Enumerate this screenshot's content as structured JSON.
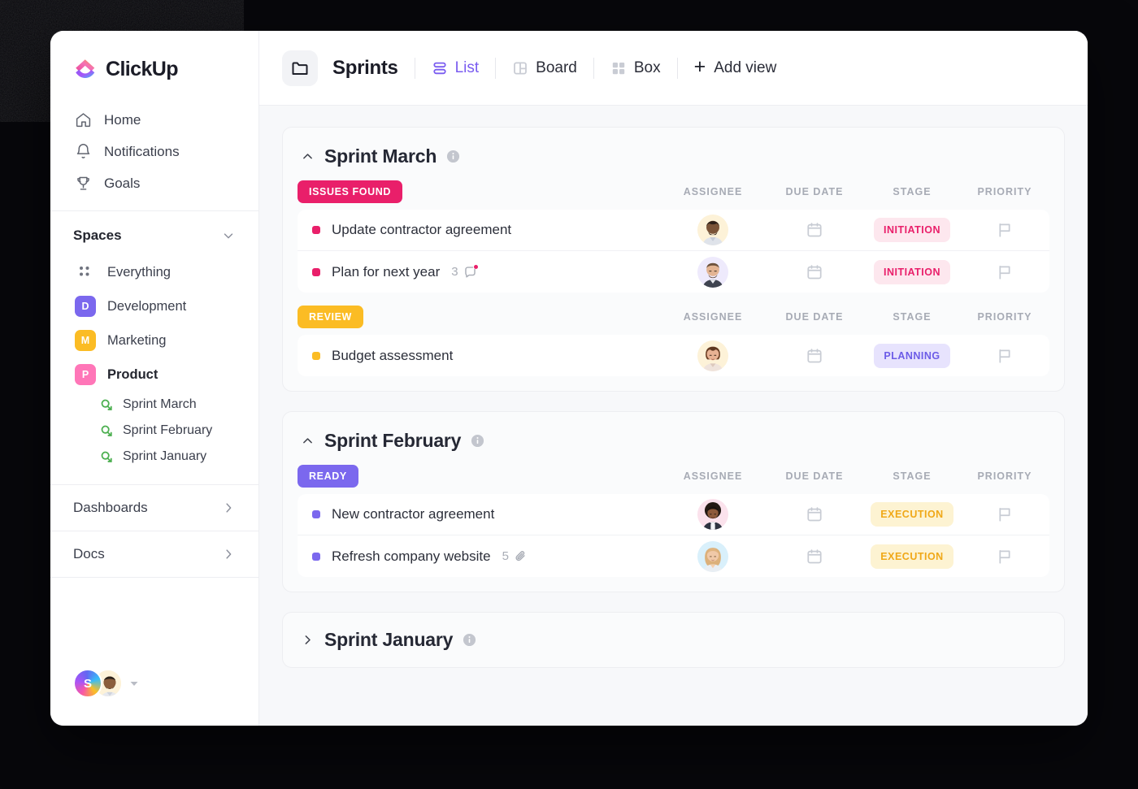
{
  "window": {
    "brand": {
      "name": "ClickUp",
      "icon": "clickup-logo"
    }
  },
  "sidebar": {
    "nav": [
      {
        "label": "Home",
        "icon": "home-icon"
      },
      {
        "label": "Notifications",
        "icon": "bell-icon"
      },
      {
        "label": "Goals",
        "icon": "trophy-icon"
      }
    ],
    "spaces_header": {
      "label": "Spaces",
      "icon": "chevron-down-icon"
    },
    "everything": {
      "label": "Everything",
      "icon": "grid-dots-icon"
    },
    "spaces": [
      {
        "label": "Development",
        "initial": "D",
        "color": "#7b68ee",
        "active": false
      },
      {
        "label": "Marketing",
        "initial": "M",
        "color": "#fbbc24",
        "active": false
      },
      {
        "label": "Product",
        "initial": "P",
        "color": "#ff76b8",
        "active": true
      }
    ],
    "sprints": [
      {
        "label": "Sprint  March",
        "icon": "sprint-icon"
      },
      {
        "label": "Sprint  February",
        "icon": "sprint-icon"
      },
      {
        "label": "Sprint January",
        "icon": "sprint-icon"
      }
    ],
    "collapsibles": [
      {
        "label": "Dashboards",
        "icon": "chevron-right-icon"
      },
      {
        "label": "Docs",
        "icon": "chevron-right-icon"
      }
    ],
    "user": {
      "workspace_initial": "S",
      "avatar": "user-avatar",
      "caret": "caret-down-icon"
    }
  },
  "topbar": {
    "folder_icon": "folder-icon",
    "title": "Sprints",
    "views": [
      {
        "label": "List",
        "icon": "list-view-icon",
        "active": true
      },
      {
        "label": "Board",
        "icon": "board-view-icon",
        "active": false
      },
      {
        "label": "Box",
        "icon": "box-view-icon",
        "active": false
      }
    ],
    "add_view": {
      "label": "Add view",
      "icon": "plus-icon"
    }
  },
  "columns": {
    "assignee": "ASSIGNEE",
    "due_date": "DUE DATE",
    "stage": "STAGE",
    "priority": "PRIORITY"
  },
  "sprints": [
    {
      "name": "Sprint March",
      "collapsed": false,
      "caret": "chevron-up-icon",
      "info": "info-icon",
      "groups": [
        {
          "status": "ISSUES FOUND",
          "status_bg": "#e91f6a",
          "status_color": "#ffffff",
          "tasks": [
            {
              "name": "Update contractor agreement",
              "bullet": "#e91f6a",
              "meta": null,
              "assignee": "avatar-bearded-man",
              "avatar_bg": "#fdf2d8",
              "due_date": "",
              "stage": "INITIATION",
              "stage_bg": "#fde7ee",
              "stage_color": "#e91f6a",
              "priority": "flag-icon"
            },
            {
              "name": "Plan for next year",
              "bullet": "#e91f6a",
              "meta": {
                "count": "3",
                "icon": "comment-icon"
              },
              "assignee": "avatar-man-short-hair",
              "avatar_bg": "#eeeafc",
              "due_date": "",
              "stage": "INITIATION",
              "stage_bg": "#fde7ee",
              "stage_color": "#e91f6a",
              "priority": "flag-icon"
            }
          ]
        },
        {
          "status": "REVIEW",
          "status_bg": "#fbbc24",
          "status_color": "#ffffff",
          "tasks": [
            {
              "name": "Budget assessment",
              "bullet": "#fbbc24",
              "meta": null,
              "assignee": "avatar-woman-brown-hair",
              "avatar_bg": "#fdf2d8",
              "due_date": "",
              "stage": "PLANNING",
              "stage_bg": "#e7e3fd",
              "stage_color": "#6c5ce7",
              "priority": "flag-icon"
            }
          ]
        }
      ]
    },
    {
      "name": "Sprint February",
      "collapsed": false,
      "caret": "chevron-up-icon",
      "info": "info-icon",
      "groups": [
        {
          "status": "READY",
          "status_bg": "#7b68ee",
          "status_color": "#ffffff",
          "tasks": [
            {
              "name": "New contractor agreement",
              "bullet": "#7b68ee",
              "meta": null,
              "assignee": "avatar-afro-man",
              "avatar_bg": "#fbe2ec",
              "due_date": "",
              "stage": "EXECUTION",
              "stage_bg": "#fdf3d2",
              "stage_color": "#f0a818",
              "priority": "flag-icon"
            },
            {
              "name": "Refresh company website",
              "bullet": "#7b68ee",
              "meta": {
                "count": "5",
                "icon": "attachment-icon"
              },
              "assignee": "avatar-blonde-woman",
              "avatar_bg": "#d9f0fb",
              "due_date": "",
              "stage": "EXECUTION",
              "stage_bg": "#fdf3d2",
              "stage_color": "#f0a818",
              "priority": "flag-icon"
            }
          ]
        }
      ]
    },
    {
      "name": "Sprint January",
      "collapsed": true,
      "caret": "chevron-right-icon",
      "info": "info-icon",
      "groups": []
    }
  ]
}
